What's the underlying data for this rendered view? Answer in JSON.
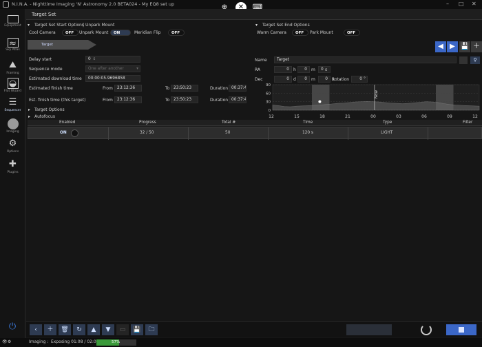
{
  "window": {
    "title": "N.I.N.A. - Nighttime Imaging 'N' Astronomy 2.0 BETA024   -   My EQ8 set up"
  },
  "sidebar": {
    "items": [
      {
        "label": "Equipment"
      },
      {
        "label": "Sky Atlas"
      },
      {
        "label": "Framing"
      },
      {
        "label": "Flat Wizard"
      },
      {
        "label": "Sequencer"
      },
      {
        "label": "Imaging"
      },
      {
        "label": "Options"
      },
      {
        "label": "Plugins"
      }
    ]
  },
  "header": {
    "title": "Target Set"
  },
  "start_options": {
    "title": "Target Set Start Options",
    "separator": "|",
    "unpark_title": "Unpark Mount",
    "cool_camera": {
      "label": "Cool Camera",
      "state": "OFF"
    },
    "unpark_mount": {
      "label": "Unpark Mount",
      "state": "ON"
    },
    "meridian_flip": {
      "label": "Meridian Flip",
      "state": "OFF"
    }
  },
  "end_options": {
    "title": "Target Set End Options",
    "warm_camera": {
      "label": "Warm Camera",
      "state": "OFF"
    },
    "park_mount": {
      "label": "Park Mount",
      "state": "OFF"
    }
  },
  "target_tab": {
    "label": "Target"
  },
  "form": {
    "delay_start": {
      "label": "Delay start",
      "value": "0",
      "unit": "s"
    },
    "sequence_mode": {
      "label": "Sequence mode",
      "value": "One after another"
    },
    "download_time": {
      "label": "Estimated download time",
      "value": "00:00:05.9696858"
    },
    "finish_time": {
      "label": "Estimated finish time",
      "from_label": "From",
      "from": "23:12:36",
      "to_label": "To",
      "to": "23:50:23",
      "duration_label": "Duration",
      "duration": "00:37:47"
    },
    "finish_time_target": {
      "label": "Est. finish time (this target)",
      "from_label": "From",
      "from": "23:12:36",
      "to_label": "To",
      "to": "23:50:23",
      "duration_label": "Duration",
      "duration": "00:37:47"
    }
  },
  "target": {
    "name_label": "Name",
    "name": "Target",
    "ra_label": "RA",
    "ra_h": "0",
    "ra_h_unit": "h",
    "ra_m": "0",
    "ra_m_unit": "m",
    "ra_s": "0",
    "ra_s_unit": "s",
    "dec_label": "Dec",
    "dec_d": "0",
    "dec_d_unit": "d",
    "dec_m": "0",
    "dec_m_unit": "m",
    "dec_s": "0",
    "dec_s_unit": "s",
    "rotation_label": "Rotation",
    "rotation": "0",
    "rotation_unit": "°"
  },
  "chart_data": {
    "type": "area",
    "title": "",
    "xlabel": "",
    "ylabel": "",
    "x_ticks": [
      "12",
      "15",
      "18",
      "21",
      "00",
      "03",
      "06",
      "09",
      "12"
    ],
    "y_ticks": [
      0,
      30,
      60,
      90
    ],
    "ylim": [
      0,
      90
    ],
    "now_label": "Now",
    "series": [
      {
        "values": [
          18,
          16,
          13,
          12,
          14,
          15,
          16,
          17,
          18,
          20,
          22,
          24,
          25,
          27,
          29,
          30,
          31,
          30,
          29,
          27,
          25,
          24,
          23,
          24,
          26,
          28,
          30,
          29,
          27,
          23,
          20,
          18,
          17,
          16,
          15,
          14
        ]
      }
    ]
  },
  "collapsibles": {
    "target_options": "Target Options",
    "autofocus": "Autofocus"
  },
  "table": {
    "columns": [
      "Enabled",
      "Progress",
      "Total #",
      "Time",
      "Type",
      "Filter"
    ],
    "rows": [
      {
        "enabled": "ON",
        "progress": "32 / 50",
        "total": "50",
        "time": "120 s",
        "type": "LIGHT",
        "filter": ""
      }
    ]
  },
  "status": {
    "label": "Imaging :",
    "text": "Exposing 01:08 / 02:00",
    "progress_pct": 57,
    "progress_label": "57%"
  }
}
